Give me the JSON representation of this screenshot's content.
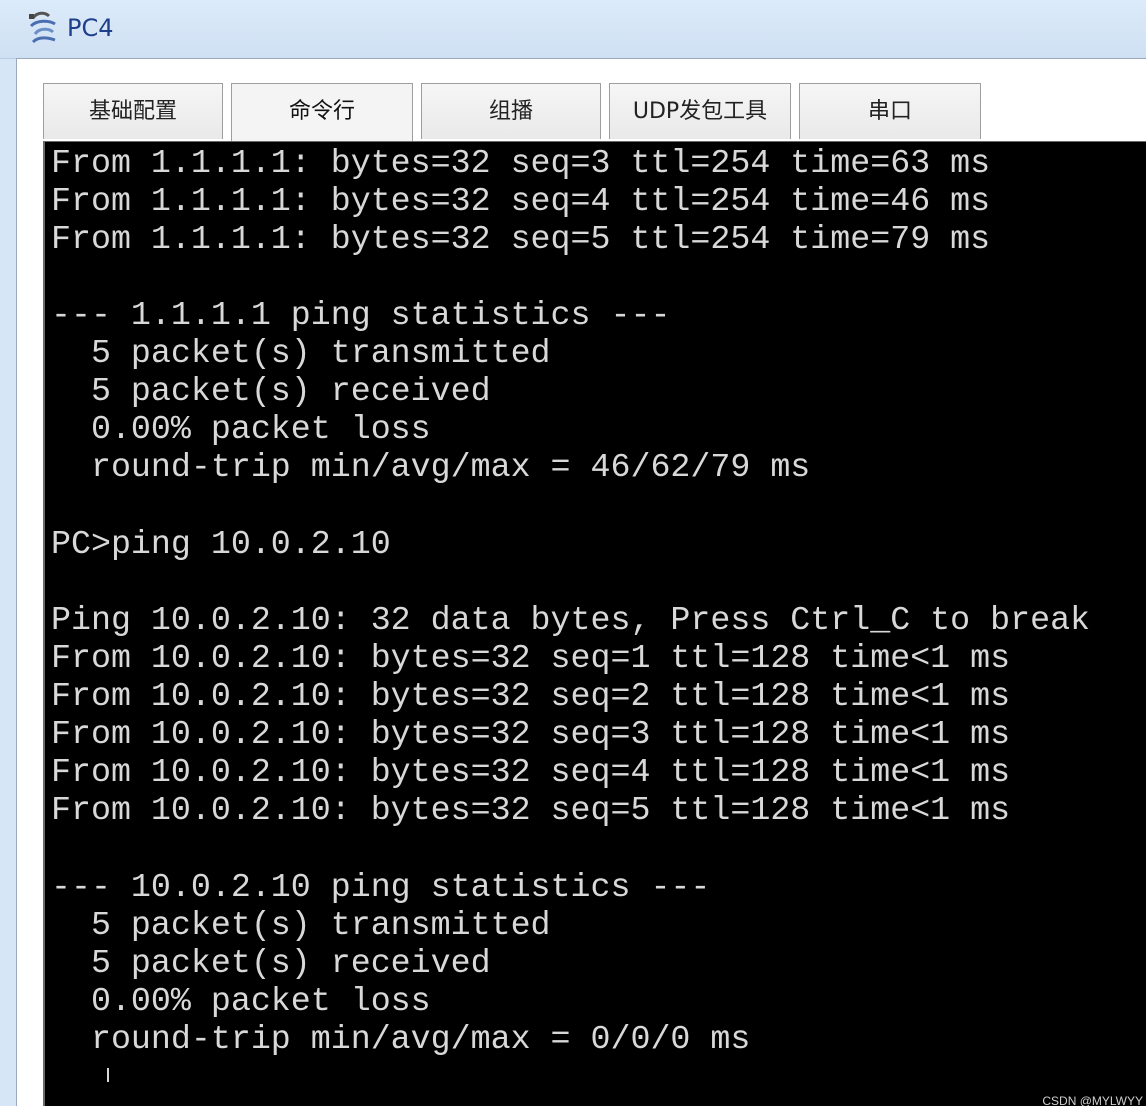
{
  "window": {
    "title": "PC4",
    "icon": "pc-device-icon"
  },
  "tabs": [
    {
      "label": "基础配置",
      "active": false
    },
    {
      "label": "命令行",
      "active": true
    },
    {
      "label": "组播",
      "active": false
    },
    {
      "label": "UDP发包工具",
      "active": false
    },
    {
      "label": "串口",
      "active": false
    }
  ],
  "terminal": {
    "lines": [
      "From 1.1.1.1: bytes=32 seq=3 ttl=254 time=63 ms",
      "From 1.1.1.1: bytes=32 seq=4 ttl=254 time=46 ms",
      "From 1.1.1.1: bytes=32 seq=5 ttl=254 time=79 ms",
      "",
      "--- 1.1.1.1 ping statistics ---",
      "  5 packet(s) transmitted",
      "  5 packet(s) received",
      "  0.00% packet loss",
      "  round-trip min/avg/max = 46/62/79 ms",
      "",
      "PC>ping 10.0.2.10",
      "",
      "Ping 10.0.2.10: 32 data bytes, Press Ctrl_C to break",
      "From 10.0.2.10: bytes=32 seq=1 ttl=128 time<1 ms",
      "From 10.0.2.10: bytes=32 seq=2 ttl=128 time<1 ms",
      "From 10.0.2.10: bytes=32 seq=3 ttl=128 time<1 ms",
      "From 10.0.2.10: bytes=32 seq=4 ttl=128 time<1 ms",
      "From 10.0.2.10: bytes=32 seq=5 ttl=128 time<1 ms",
      "",
      "--- 10.0.2.10 ping statistics ---",
      "  5 packet(s) transmitted",
      "  5 packet(s) received",
      "  0.00% packet loss",
      "  round-trip min/avg/max = 0/0/0 ms"
    ]
  },
  "watermark": "CSDN @MYLWYY",
  "colors": {
    "terminal_bg": "#000000",
    "terminal_fg": "#d8d8d8",
    "title_text": "#1e3f8a",
    "chrome_bg": "#d7e6f6"
  }
}
